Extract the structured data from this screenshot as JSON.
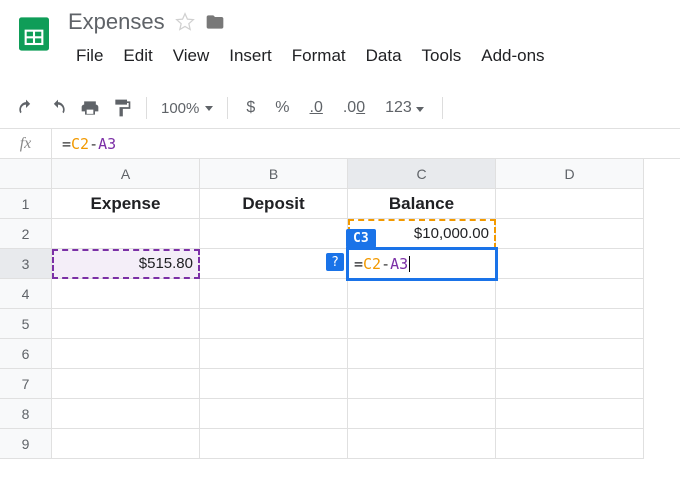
{
  "doc": {
    "title": "Expenses"
  },
  "menu": {
    "file": "File",
    "edit": "Edit",
    "view": "View",
    "insert": "Insert",
    "format": "Format",
    "data": "Data",
    "tools": "Tools",
    "addons": "Add-ons"
  },
  "toolbar": {
    "zoom": "100%",
    "dollar": "$",
    "percent": "%",
    "dec_dec": ".0",
    "inc_dec": ".00",
    "num_fmt": "123"
  },
  "formula_bar": {
    "fx": "fx",
    "eq": "=",
    "ref1": "C2",
    "op": "-",
    "ref2": "A3"
  },
  "columns": [
    "A",
    "B",
    "C",
    "D"
  ],
  "rows": [
    "1",
    "2",
    "3",
    "4",
    "5",
    "6",
    "7",
    "8",
    "9"
  ],
  "cells": {
    "A1": "Expense",
    "B1": "Deposit",
    "C1": "Balance",
    "C2": "$10,000.00",
    "A3": "$515.80"
  },
  "editing": {
    "badge": "C3",
    "help": "?",
    "eq": "=",
    "ref1": "C2",
    "op": "-",
    "ref2": "A3"
  }
}
